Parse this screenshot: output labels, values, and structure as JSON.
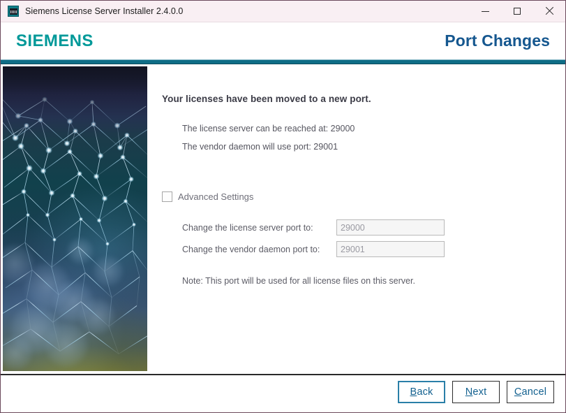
{
  "window": {
    "title": "Siemens License Server Installer 2.4.0.0",
    "app_icon": "installer-icon",
    "controls": {
      "minimize": "minimize-icon",
      "maximize": "maximize-icon",
      "close": "close-icon"
    }
  },
  "header": {
    "brand": "SIEMENS",
    "page_title": "Port Changes",
    "brand_color": "#009999",
    "title_color": "#15578f",
    "rule_color": "#0f6d86"
  },
  "artwork": {
    "name": "network-mesh-graphic"
  },
  "main": {
    "lead": "Your licenses have been moved to a new port.",
    "info_lines": [
      "The license server can be reached at: 29000",
      "The vendor daemon will use port: 29001"
    ],
    "advanced": {
      "label": "Advanced Settings",
      "checked": false
    },
    "fields": [
      {
        "label": "Change the license server port to:",
        "value": "29000",
        "enabled": false
      },
      {
        "label": "Change the vendor daemon port to:",
        "value": "29001",
        "enabled": false
      }
    ],
    "note": "Note: This port will be used for all license files on this server."
  },
  "footer": {
    "buttons": [
      {
        "mnemonic": "B",
        "rest": "ack",
        "focused": true
      },
      {
        "mnemonic": "N",
        "rest": "ext",
        "focused": false
      },
      {
        "mnemonic": "C",
        "rest": "ancel",
        "focused": false
      }
    ]
  }
}
